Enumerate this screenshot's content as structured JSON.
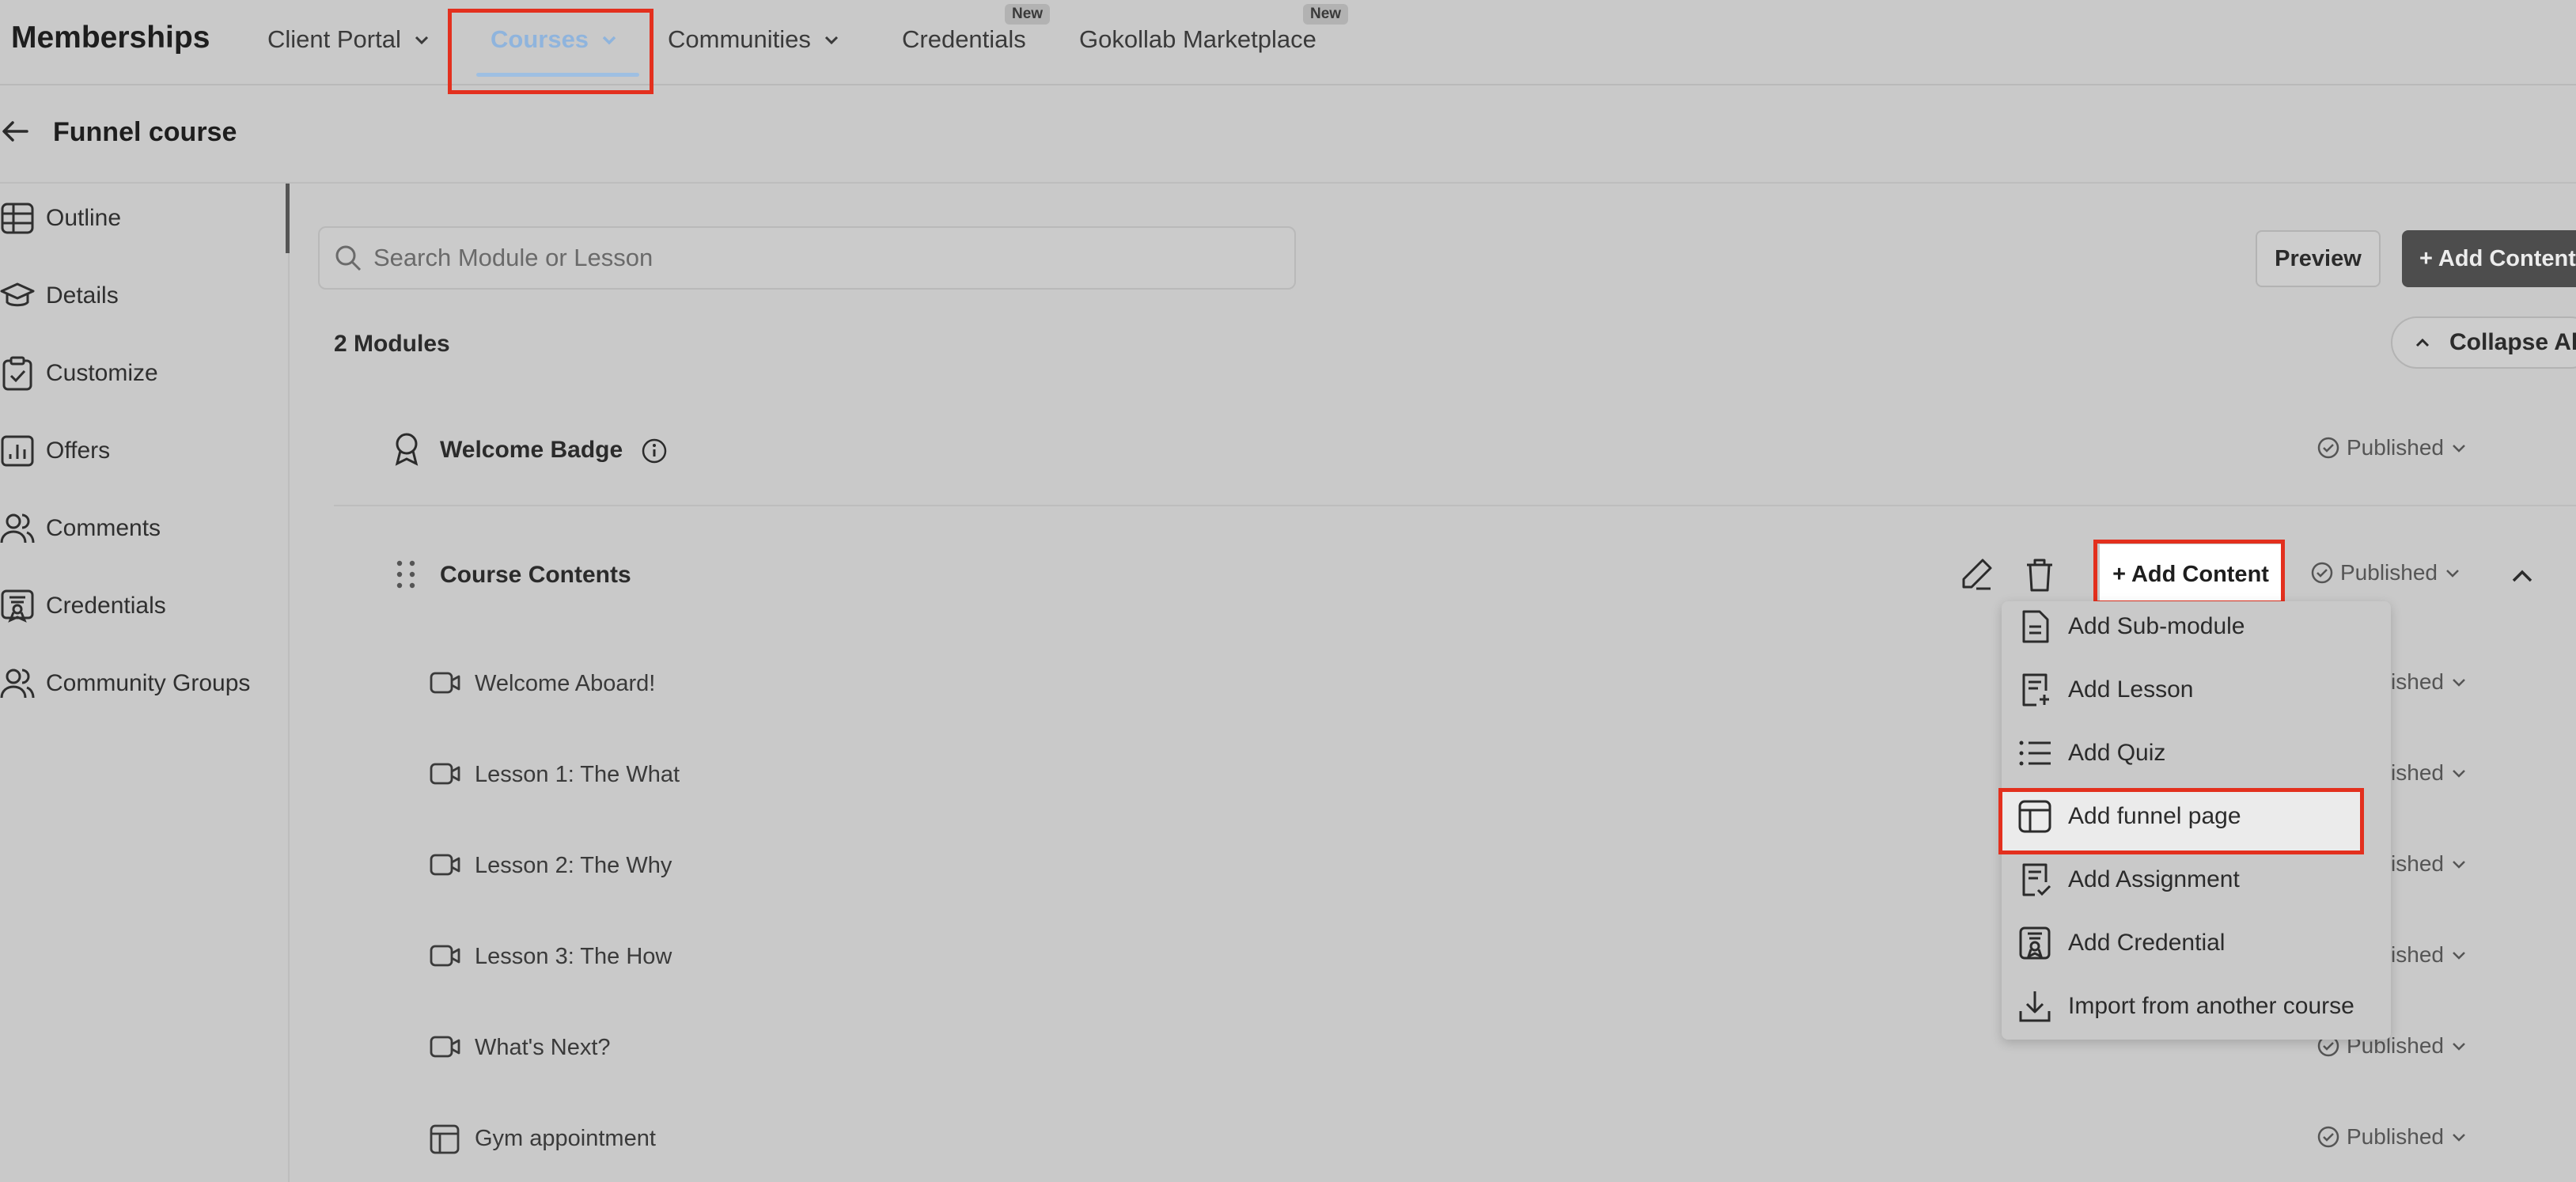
{
  "app": {
    "title": "Memberships"
  },
  "nav": {
    "client_portal": "Client Portal",
    "courses": "Courses",
    "communities": "Communities",
    "credentials": "Credentials",
    "marketplace": "Gokollab Marketplace",
    "new_badge": "New"
  },
  "header": {
    "back_icon": "arrow-left-icon",
    "course_title": "Funnel course"
  },
  "sidebar": {
    "items": [
      {
        "label": "Outline",
        "icon": "table-icon"
      },
      {
        "label": "Details",
        "icon": "graduation-cap-icon"
      },
      {
        "label": "Customize",
        "icon": "clipboard-check-icon"
      },
      {
        "label": "Offers",
        "icon": "chart-icon"
      },
      {
        "label": "Comments",
        "icon": "users-icon"
      },
      {
        "label": "Credentials",
        "icon": "certificate-icon"
      },
      {
        "label": "Community Groups",
        "icon": "users-icon"
      }
    ]
  },
  "main": {
    "search_placeholder": "Search Module or Lesson",
    "preview_label": "Preview",
    "add_content_label": "+ Add Content",
    "modules_count": "2 Modules",
    "collapse_label": "Collapse All",
    "status_published": "Published",
    "modules": [
      {
        "title": "Welcome Badge",
        "status": "Published"
      },
      {
        "title": "Course Contents",
        "status": "Published",
        "add_label": "+ Add Content"
      }
    ],
    "lessons": [
      {
        "title": "Welcome Aboard!",
        "icon": "video-icon",
        "status": "Published"
      },
      {
        "title": "Lesson 1: The What",
        "icon": "video-icon",
        "status": "Published"
      },
      {
        "title": "Lesson 2: The Why",
        "icon": "video-icon",
        "status": "Published"
      },
      {
        "title": "Lesson 3: The How",
        "icon": "video-icon",
        "status": "Published"
      },
      {
        "title": "What's Next?",
        "icon": "video-icon",
        "status": "Published"
      },
      {
        "title": "Gym appointment",
        "icon": "layout-icon",
        "status": "Published"
      }
    ]
  },
  "dropdown": {
    "items": [
      {
        "label": "Add Sub-module",
        "icon": "file-icon"
      },
      {
        "label": "Add Lesson",
        "icon": "file-plus-icon"
      },
      {
        "label": "Add Quiz",
        "icon": "list-icon"
      },
      {
        "label": "Add funnel page",
        "icon": "layout-icon"
      },
      {
        "label": "Add Assignment",
        "icon": "file-check-icon"
      },
      {
        "label": "Add Credential",
        "icon": "certificate-icon"
      },
      {
        "label": "Import from another course",
        "icon": "download-icon"
      }
    ]
  },
  "colors": {
    "highlight": "#e3301e",
    "active_nav": "#8fb4dd",
    "background": "#c9c9c9"
  }
}
